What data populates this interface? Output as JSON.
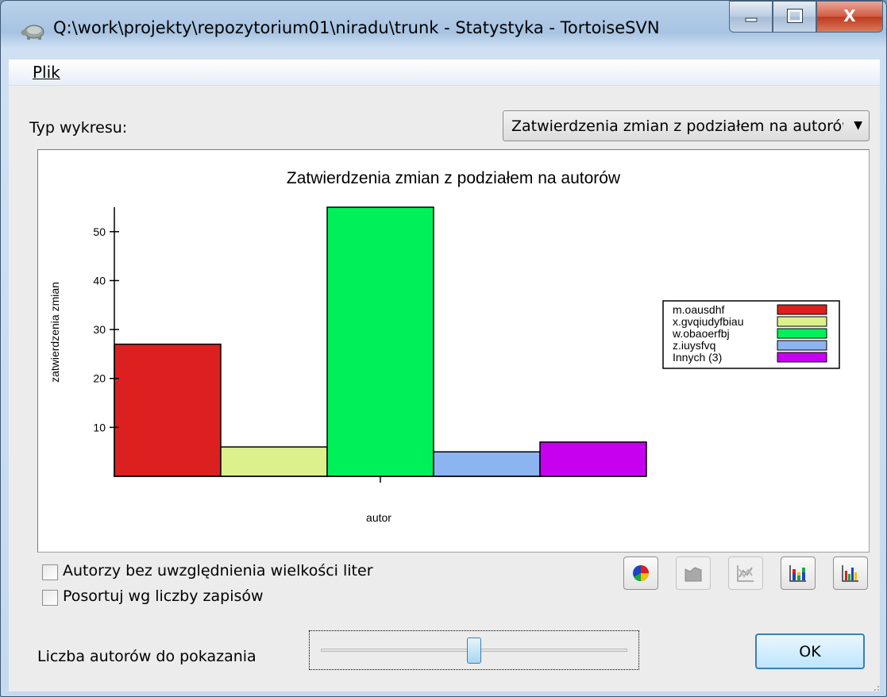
{
  "window": {
    "title": "Q:\\work\\projekty\\repozytorium01\\niradu\\trunk - Statystyka - TortoiseSVN",
    "buttons": {
      "minimize": "–",
      "maximize": "□",
      "close": "X"
    }
  },
  "menu": {
    "items": [
      {
        "label": "Plik"
      }
    ]
  },
  "graph_type": {
    "label": "Typ wykresu:",
    "selected": "Zatwierdzenia zmian z podziałem na autorów"
  },
  "chart_data": {
    "type": "bar",
    "title": "Zatwierdzenia zmian z podziałem na autorów",
    "xlabel": "autor",
    "ylabel": "zatwierdzenia zmian",
    "ylim": [
      0,
      55
    ],
    "yticks": [
      10,
      20,
      30,
      40,
      50
    ],
    "grid": false,
    "legend_position": "right",
    "categories": [
      "m.oausdhf",
      "x.gvqiudyfbiau",
      "w.obaoerfbj",
      "z.iuysfvq",
      "Innych (3)"
    ],
    "values": [
      27,
      6,
      55,
      5,
      7
    ],
    "colors": [
      "#dc2020",
      "#dcf08c",
      "#00f05a",
      "#8cb4f0",
      "#c800f0"
    ]
  },
  "options": {
    "case_insensitive_label": "Autorzy bez uwzględnienia wielkości liter",
    "case_insensitive_checked": false,
    "sort_label": "Posortuj wg liczby zapisów",
    "sort_checked": false
  },
  "toolbar": [
    {
      "name": "pie-chart-button",
      "icon": "pie-chart-icon",
      "enabled": true
    },
    {
      "name": "stacked-area-button",
      "icon": "area-chart-icon",
      "enabled": false
    },
    {
      "name": "line-chart-button",
      "icon": "line-chart-icon",
      "enabled": false
    },
    {
      "name": "stacked-bar-button",
      "icon": "stacked-bar-icon",
      "enabled": true
    },
    {
      "name": "bar-chart-button",
      "icon": "bar-chart-icon",
      "enabled": true
    }
  ],
  "authors_slider": {
    "label": "Liczba autorów do pokazania",
    "value_fraction": 0.5
  },
  "ok_button": {
    "label": "OK"
  }
}
